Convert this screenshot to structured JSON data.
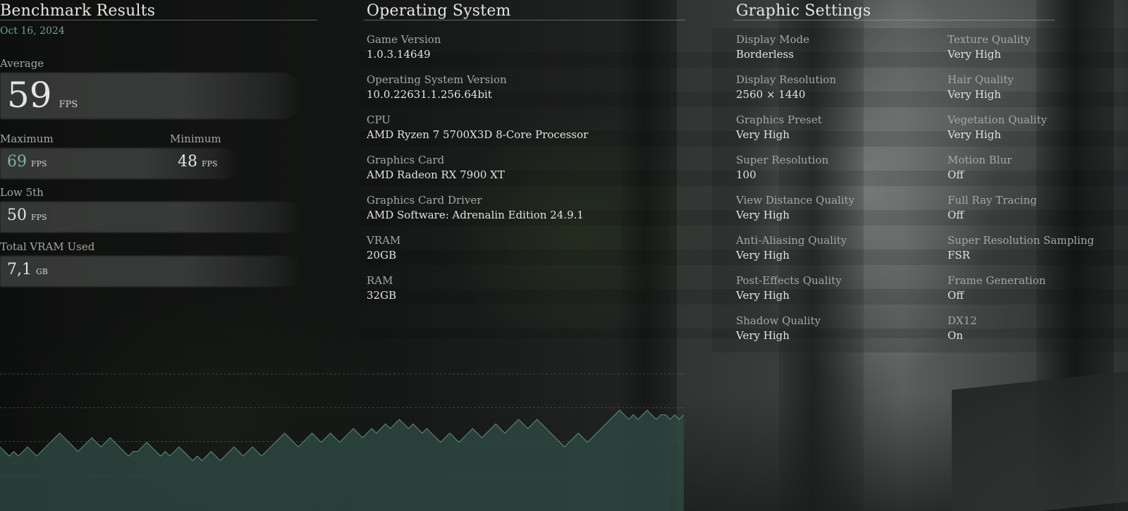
{
  "benchmark": {
    "title": "Benchmark Results",
    "date": "Oct 16, 2024",
    "average": {
      "label": "Average",
      "value": "59",
      "unit": "FPS"
    },
    "maximum": {
      "label": "Maximum",
      "value": "69",
      "unit": "FPS"
    },
    "minimum": {
      "label": "Minimum",
      "value": "48",
      "unit": "FPS"
    },
    "low5th": {
      "label": "Low 5th",
      "value": "50",
      "unit": "FPS"
    },
    "vram_used": {
      "label": "Total VRAM Used",
      "value": "7,1",
      "unit": "GB"
    }
  },
  "os": {
    "title": "Operating System",
    "items": [
      {
        "label": "Game Version",
        "value": "1.0.3.14649"
      },
      {
        "label": "Operating System Version",
        "value": "10.0.22631.1.256.64bit"
      },
      {
        "label": "CPU",
        "value": "AMD Ryzen 7 5700X3D 8-Core Processor"
      },
      {
        "label": "Graphics Card",
        "value": "AMD Radeon RX 7900 XT"
      },
      {
        "label": "Graphics Card Driver",
        "value": "AMD Software: Adrenalin Edition 24.9.1"
      },
      {
        "label": "VRAM",
        "value": "20GB"
      },
      {
        "label": "RAM",
        "value": "32GB"
      }
    ]
  },
  "graphics": {
    "title": "Graphic Settings",
    "left": [
      {
        "label": "Display Mode",
        "value": "Borderless"
      },
      {
        "label": "Display Resolution",
        "value": "2560 × 1440"
      },
      {
        "label": "Graphics Preset",
        "value": "Very High"
      },
      {
        "label": "Super Resolution",
        "value": "100"
      },
      {
        "label": "View Distance Quality",
        "value": "Very High"
      },
      {
        "label": "Anti-Aliasing Quality",
        "value": "Very High"
      },
      {
        "label": "Post-Effects Quality",
        "value": "Very High"
      },
      {
        "label": "Shadow Quality",
        "value": "Very High"
      }
    ],
    "right": [
      {
        "label": "Texture Quality",
        "value": "Very High"
      },
      {
        "label": "Hair Quality",
        "value": "Very High"
      },
      {
        "label": "Vegetation Quality",
        "value": "Very High"
      },
      {
        "label": "Motion Blur",
        "value": "Off"
      },
      {
        "label": "Full Ray Tracing",
        "value": "Off"
      },
      {
        "label": "Super Resolution Sampling",
        "value": "FSR"
      },
      {
        "label": "Frame Generation",
        "value": "Off"
      },
      {
        "label": "DX12",
        "value": "On"
      }
    ]
  },
  "colors": {
    "accent": "#7ab3a8",
    "date": "#6fa39a",
    "chart_fill": "#2f4a44",
    "chart_line": "#5f8a80"
  },
  "chart_data": {
    "type": "area",
    "ylim": [
      45,
      75
    ],
    "grid": true,
    "values": [
      59,
      58,
      57,
      58,
      57,
      58,
      59,
      58,
      57,
      58,
      59,
      60,
      61,
      62,
      61,
      60,
      59,
      58,
      59,
      60,
      61,
      60,
      59,
      60,
      61,
      60,
      59,
      58,
      57,
      58,
      58,
      59,
      60,
      59,
      58,
      57,
      58,
      57,
      58,
      59,
      58,
      57,
      56,
      57,
      56,
      57,
      58,
      57,
      56,
      57,
      58,
      59,
      58,
      57,
      58,
      59,
      58,
      57,
      58,
      59,
      60,
      61,
      62,
      61,
      60,
      59,
      60,
      61,
      62,
      61,
      60,
      61,
      62,
      61,
      60,
      61,
      62,
      63,
      62,
      61,
      62,
      63,
      62,
      63,
      64,
      63,
      64,
      65,
      64,
      63,
      64,
      63,
      62,
      63,
      62,
      61,
      60,
      61,
      62,
      61,
      60,
      61,
      62,
      63,
      62,
      61,
      62,
      63,
      64,
      63,
      62,
      63,
      64,
      65,
      64,
      63,
      64,
      65,
      64,
      63,
      62,
      61,
      60,
      59,
      60,
      61,
      62,
      61,
      60,
      61,
      62,
      63,
      64,
      65,
      66,
      67,
      66,
      65,
      66,
      65,
      66,
      67,
      66,
      65,
      66,
      66,
      65,
      66,
      65,
      66
    ]
  }
}
